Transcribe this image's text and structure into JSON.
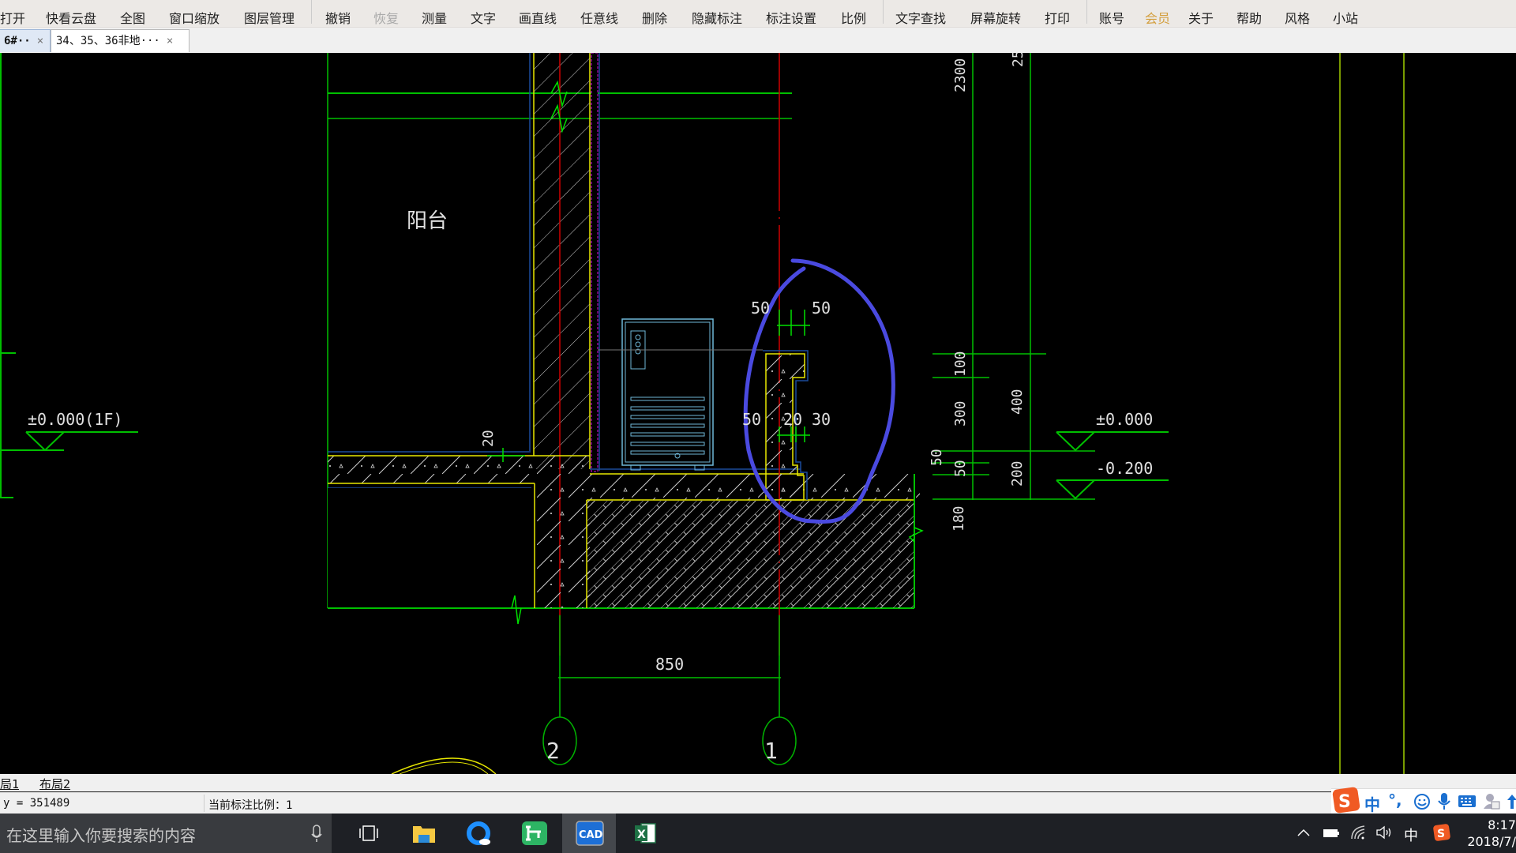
{
  "toolbar": {
    "items": [
      {
        "label": "打开",
        "icon": "open-icon"
      },
      {
        "label": "快看云盘",
        "icon": "cloud-icon"
      },
      {
        "label": "全图",
        "icon": "fullview-icon"
      },
      {
        "label": "窗口缩放",
        "icon": "zoom-window-icon"
      },
      {
        "label": "图层管理",
        "icon": "layers-icon"
      },
      {
        "label": "撤销",
        "icon": "undo-icon"
      },
      {
        "label": "恢复",
        "icon": "redo-icon",
        "disabled": true
      },
      {
        "label": "测量",
        "icon": "measure-icon"
      },
      {
        "label": "文字",
        "icon": "text-icon"
      },
      {
        "label": "画直线",
        "icon": "line-icon"
      },
      {
        "label": "任意线",
        "icon": "freeline-icon"
      },
      {
        "label": "删除",
        "icon": "eraser-icon"
      },
      {
        "label": "隐藏标注",
        "icon": "hide-annotation-icon"
      },
      {
        "label": "标注设置",
        "icon": "annotation-settings-icon"
      },
      {
        "label": "比例",
        "icon": "scale-icon"
      },
      {
        "label": "文字查找",
        "icon": "text-search-icon"
      },
      {
        "label": "屏幕旋转",
        "icon": "rotate-screen-icon"
      },
      {
        "label": "打印",
        "icon": "print-icon"
      },
      {
        "label": "账号",
        "icon": "account-icon"
      },
      {
        "label": "会员",
        "icon": "vip-icon"
      },
      {
        "label": "关于",
        "icon": "about-icon"
      },
      {
        "label": "帮助",
        "icon": "help-icon"
      },
      {
        "label": "风格",
        "icon": "style-icon"
      },
      {
        "label": "小站",
        "icon": "station-icon"
      }
    ]
  },
  "tabs": [
    {
      "label": "6#··",
      "close": "×",
      "active": true
    },
    {
      "label": "34、35、36非地···",
      "close": "×",
      "active": false
    }
  ],
  "drawing": {
    "room_label": "阳台",
    "elevation_left": "±0.000(1F)",
    "elevation_right_1": "±0.000",
    "elevation_right_2": "-0.200",
    "dim_850": "850",
    "dim_20_floor": "20",
    "dim_50_a": "50",
    "dim_50_b": "50",
    "dim_50_c": "50",
    "dim_20_curb": "20",
    "dim_30": "30",
    "dim_2300": "2300",
    "dim_25": "25",
    "dim_100": "100",
    "dim_300": "300",
    "dim_400": "400",
    "dim_50_v1": "50",
    "dim_50_v2": "50",
    "dim_200": "200",
    "dim_180": "180",
    "axis_2": "2",
    "axis_1": "1",
    "colors": {
      "background": "#000000",
      "dim_green": "#00c000",
      "wall_yellow": "#e8e800",
      "axis_red": "#d00000",
      "insulation_magenta": "#e000e0",
      "equipment_cyan": "#6fb8d8",
      "annotation_blue": "#4a4ae0"
    }
  },
  "layout_tabs": [
    "局1",
    "布局2"
  ],
  "status": {
    "coord": "y = 351489",
    "scale": "当前标注比例：1"
  },
  "taskbar": {
    "search_placeholder": "在这里输入你要搜索的内容",
    "apps": [
      "task-view",
      "file-explorer",
      "browser",
      "green-app",
      "cad-viewer",
      "excel"
    ],
    "ime_lang": "中",
    "time": "8:17",
    "date": "2018/7/"
  },
  "ime": {
    "lang": "中",
    "punct": "°,"
  }
}
